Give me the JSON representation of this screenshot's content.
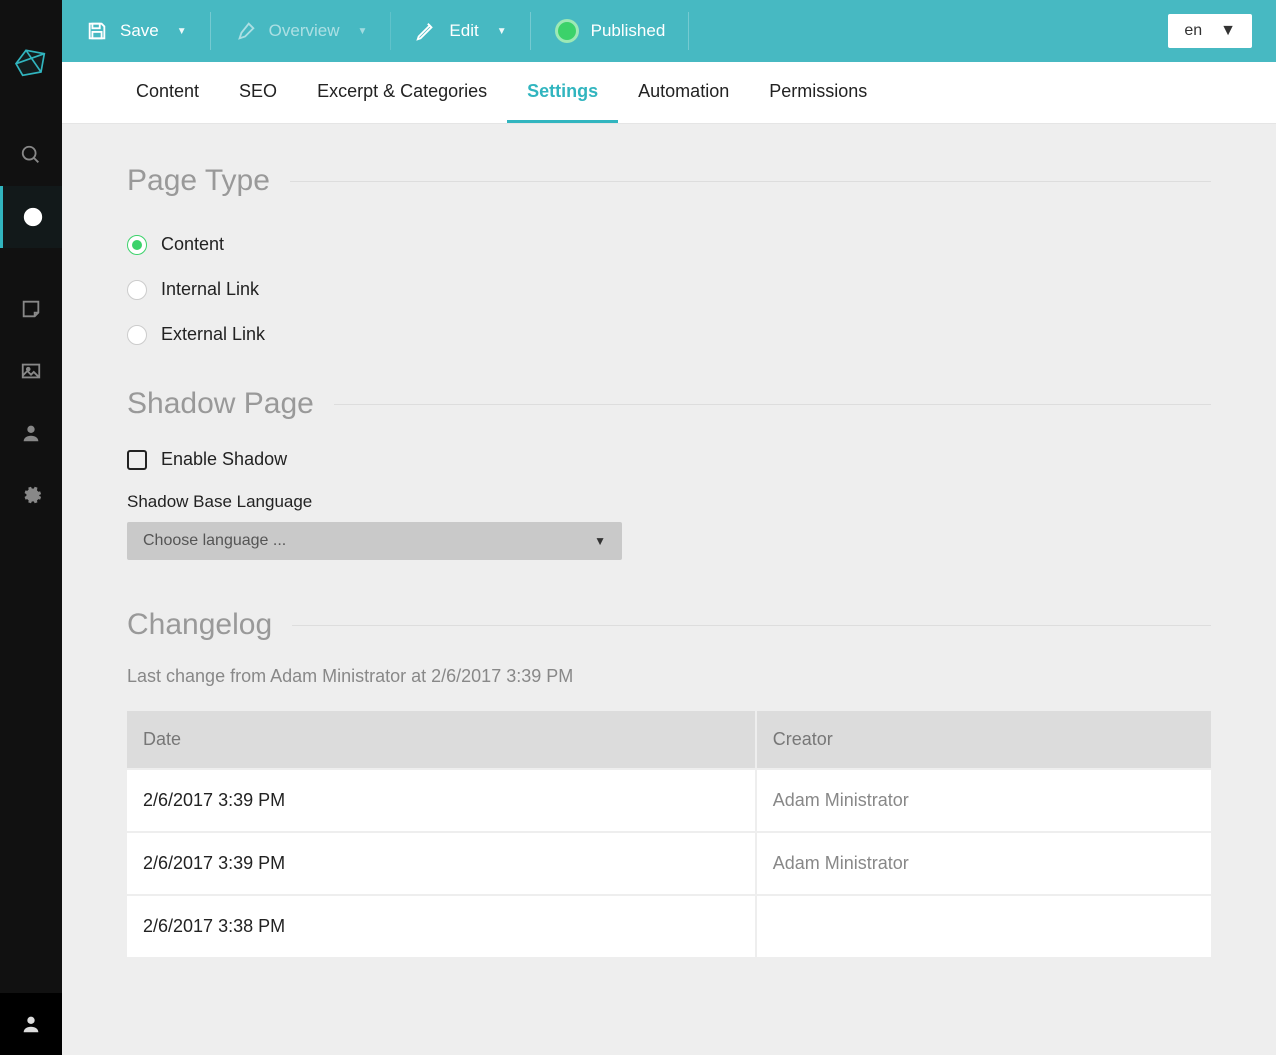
{
  "topbar": {
    "save_label": "Save",
    "overview_label": "Overview",
    "edit_label": "Edit",
    "published_label": "Published"
  },
  "language_selector": {
    "value": "en"
  },
  "tabs": [
    {
      "label": "Content",
      "active": false
    },
    {
      "label": "SEO",
      "active": false
    },
    {
      "label": "Excerpt & Categories",
      "active": false
    },
    {
      "label": "Settings",
      "active": true
    },
    {
      "label": "Automation",
      "active": false
    },
    {
      "label": "Permissions",
      "active": false
    }
  ],
  "sections": {
    "page_type": {
      "title": "Page Type",
      "options": [
        {
          "label": "Content",
          "selected": true
        },
        {
          "label": "Internal Link",
          "selected": false
        },
        {
          "label": "External Link",
          "selected": false
        }
      ]
    },
    "shadow_page": {
      "title": "Shadow Page",
      "enable_label": "Enable Shadow",
      "enabled": false,
      "base_language_label": "Shadow Base Language",
      "language_select_placeholder": "Choose language ..."
    },
    "changelog": {
      "title": "Changelog",
      "subtitle": "Last change from Adam Ministrator at 2/6/2017 3:39 PM",
      "columns": {
        "date": "Date",
        "creator": "Creator"
      },
      "rows": [
        {
          "date": "2/6/2017 3:39 PM",
          "creator": "Adam Ministrator"
        },
        {
          "date": "2/6/2017 3:39 PM",
          "creator": "Adam Ministrator"
        },
        {
          "date": "2/6/2017 3:38 PM",
          "creator": ""
        }
      ]
    }
  }
}
